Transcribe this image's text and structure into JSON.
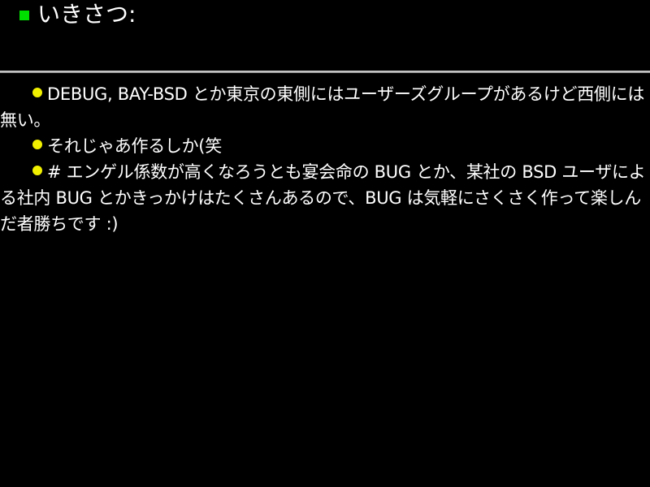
{
  "colors": {
    "background": "#000000",
    "title_bullet": "#00e000",
    "item_bullet": "#f0f000",
    "text": "#ffffff",
    "divider": "#a0a0a0"
  },
  "slide": {
    "title": "いきさつ:",
    "items": [
      {
        "text": "DEBUG, BAY-BSD とか東京の東側にはユーザーズグループがあるけど西側には無い。"
      },
      {
        "text": "それじゃあ作るしか(笑"
      },
      {
        "text": "# エンゲル係数が高くなろうとも宴会命の BUG とか、某社の BSD ユーザによる社内 BUG とかきっかけはたくさんあるので、BUG は気軽にさくさく作って楽しんだ者勝ちです :)"
      }
    ]
  }
}
